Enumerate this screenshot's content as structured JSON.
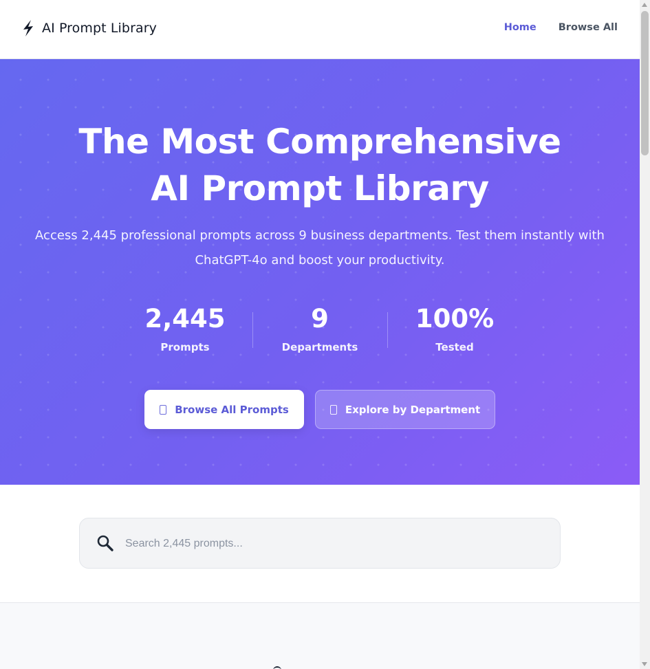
{
  "header": {
    "brand": "AI Prompt Library",
    "logo_icon": "lightning-bolt-icon",
    "nav": [
      {
        "label": "Home",
        "active": true
      },
      {
        "label": "Browse All",
        "active": false
      }
    ]
  },
  "hero": {
    "title_line1": "The Most Comprehensive",
    "title_line2": "AI Prompt Library",
    "subtitle": "Access 2,445 professional prompts across 9 business departments. Test them instantly with ChatGPT-4o and boost your productivity.",
    "stats": [
      {
        "value": "2,445",
        "label": "Prompts"
      },
      {
        "value": "9",
        "label": "Departments"
      },
      {
        "value": "100%",
        "label": "Tested"
      }
    ],
    "primary_button": "Browse All Prompts",
    "secondary_button": "Explore by Department"
  },
  "search": {
    "placeholder": "Search 2,445 prompts...",
    "icon": "search-icon",
    "value": ""
  },
  "colors": {
    "accent": "#5b5bd6",
    "hero_gradient_start": "#6568f0",
    "hero_gradient_end": "#8b5cf6"
  }
}
